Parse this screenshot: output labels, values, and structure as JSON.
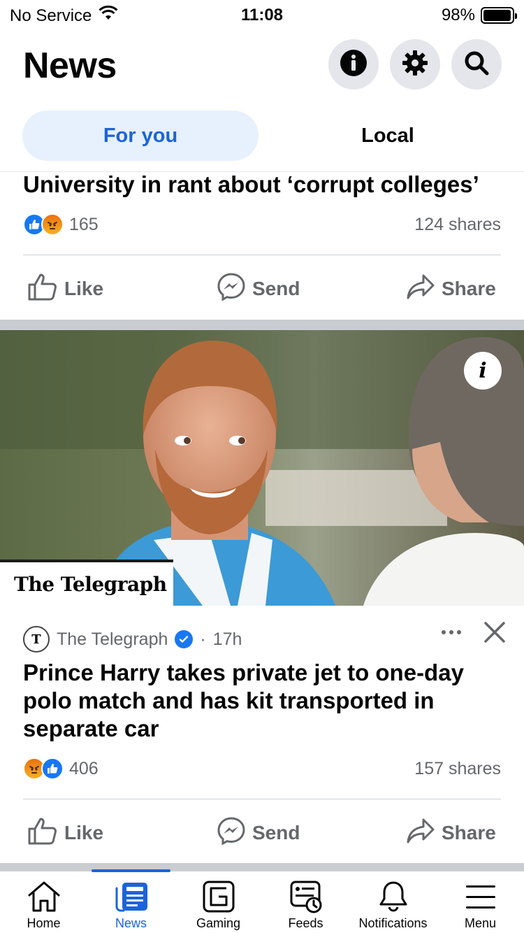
{
  "status_bar": {
    "carrier": "No Service",
    "time": "11:08",
    "battery": "98%",
    "battery_level": 0.98
  },
  "header": {
    "title": "News"
  },
  "tabs": [
    {
      "label": "For you",
      "active": true
    },
    {
      "label": "Local",
      "active": false
    }
  ],
  "post1": {
    "title_fragment": "University in rant about ‘corrupt colleges’",
    "reaction_count": "165",
    "shares": "124 shares",
    "actions": {
      "like": "Like",
      "send": "Send",
      "share": "Share"
    }
  },
  "post2": {
    "image_overlay_brand": "The Telegraph",
    "source": "The Telegraph",
    "time": "17h",
    "separator": "·",
    "title": "Prince Harry takes private jet to one-day polo match and has kit transported in separate car",
    "reaction_count": "406",
    "shares": "157 shares",
    "actions": {
      "like": "Like",
      "send": "Send",
      "share": "Share"
    }
  },
  "bottom_nav": [
    {
      "label": "Home",
      "icon": "home-icon"
    },
    {
      "label": "News",
      "icon": "news-icon",
      "active": true
    },
    {
      "label": "Gaming",
      "icon": "gaming-icon"
    },
    {
      "label": "Feeds",
      "icon": "feeds-icon"
    },
    {
      "label": "Notifications",
      "icon": "bell-icon"
    },
    {
      "label": "Menu",
      "icon": "menu-icon"
    }
  ],
  "colors": {
    "accent": "#1b64d8",
    "tab_active_bg": "#e7f0fd",
    "secondary_text": "#65676b",
    "button_bg": "#e4e6eb"
  }
}
